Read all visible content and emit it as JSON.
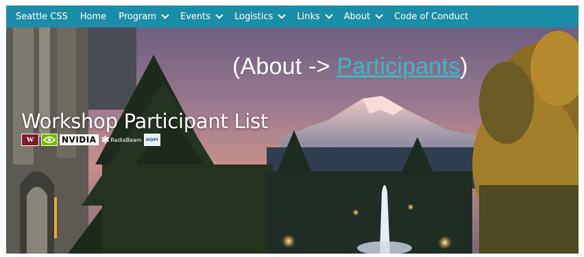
{
  "nav": {
    "items": [
      {
        "label": "Seattle CSS",
        "dropdown": false
      },
      {
        "label": "Home",
        "dropdown": false
      },
      {
        "label": "Program",
        "dropdown": true
      },
      {
        "label": "Events",
        "dropdown": true
      },
      {
        "label": "Logistics",
        "dropdown": true
      },
      {
        "label": "Links",
        "dropdown": true
      },
      {
        "label": "About",
        "dropdown": true
      },
      {
        "label": "Code of Conduct",
        "dropdown": false
      }
    ],
    "background": "#1c8da8"
  },
  "hero": {
    "breadcrumb_prefix": "(About -> ",
    "breadcrumb_link": "Participants",
    "breadcrumb_suffix": ")",
    "title": "Workshop Participant List",
    "sponsors": {
      "washington": "W",
      "nvidia": "NVIDIA",
      "radiabeam": "RadiaBeam",
      "mdpi": "MDPI"
    }
  },
  "colors": {
    "link": "#3fb6c6",
    "nav_bg": "#1c8da8"
  }
}
